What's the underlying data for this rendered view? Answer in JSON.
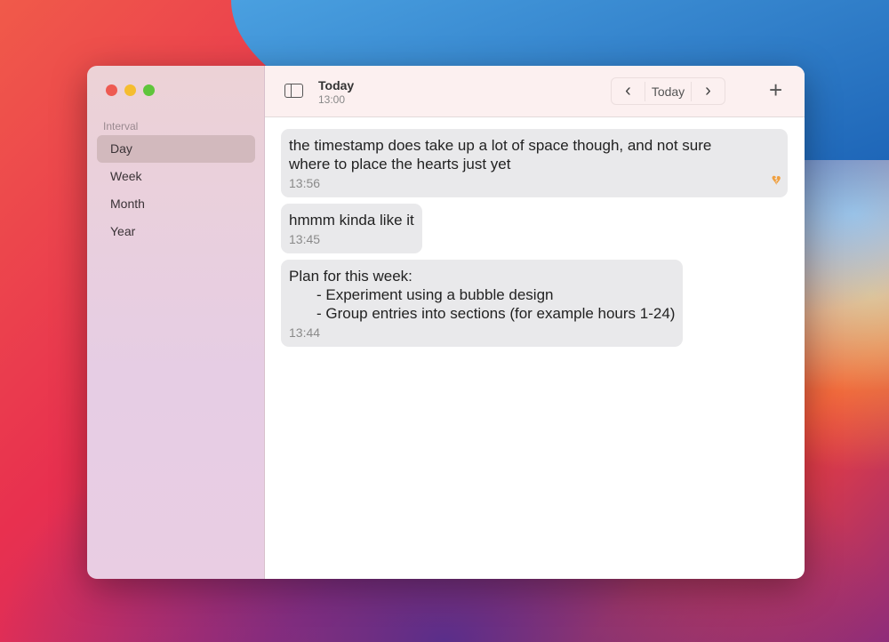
{
  "sidebar": {
    "section": "Interval",
    "items": [
      "Day",
      "Week",
      "Month",
      "Year"
    ]
  },
  "toolbar": {
    "title": "Today",
    "subtitle": "13:00",
    "today_label": "Today",
    "prev": "‹",
    "next": "›",
    "add": "+"
  },
  "messages": [
    {
      "lines": [
        "the timestamp does take up a lot of space though, and not sure",
        "where to place the hearts just yet"
      ],
      "time": "13:56",
      "heart": "broken-heart"
    },
    {
      "lines": [
        "hmmm kinda like it"
      ],
      "time": "13:45"
    },
    {
      "lines": [
        "Plan for this week:",
        "- Experiment using a bubble design",
        "- Group entries into sections (for example hours 1-24)"
      ],
      "time": "13:44"
    }
  ],
  "colors": {
    "heart": "#f0a040",
    "accent_sel": "#d2b9bd"
  }
}
